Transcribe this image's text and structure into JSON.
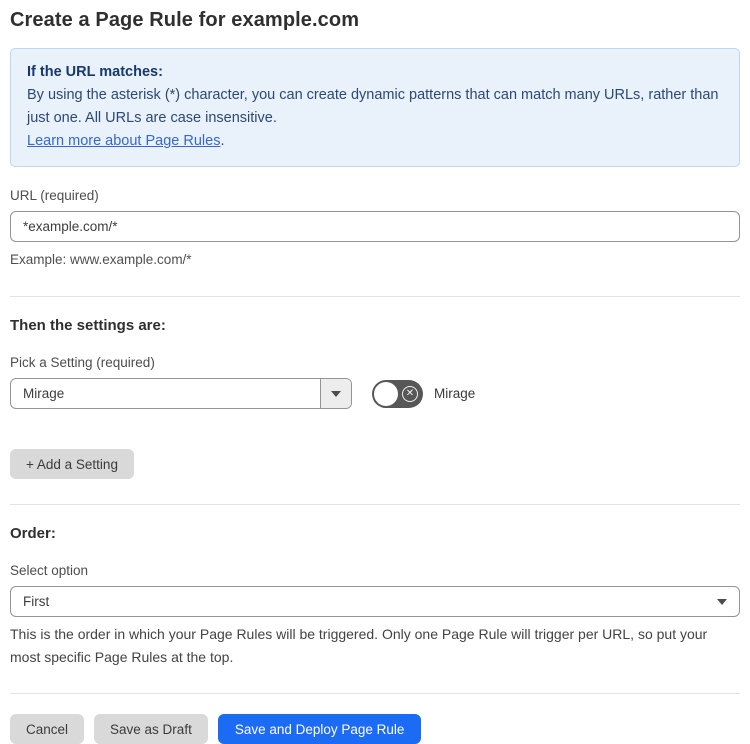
{
  "page": {
    "title": "Create a Page Rule for example.com"
  },
  "info_box": {
    "heading": "If the URL matches:",
    "body": "By using the asterisk (*) character, you can create dynamic patterns that can match many URLs, rather than just one. All URLs are case insensitive.",
    "link": "Learn more about Page Rules",
    "link_suffix": "."
  },
  "url_field": {
    "label": "URL (required)",
    "value": "*example.com/*",
    "helper": "Example: www.example.com/*"
  },
  "settings_section": {
    "heading": "Then the settings are:",
    "picker_label": "Pick a Setting (required)",
    "picker_value": "Mirage",
    "toggle_state": "off",
    "toggle_label": "Mirage",
    "add_button_label": "+ Add a Setting"
  },
  "order_section": {
    "heading": "Order:",
    "select_label": "Select option",
    "select_value": "First",
    "helper": "This is the order in which your Page Rules will be triggered. Only one Page Rule will trigger per URL, so put your most specific Page Rules at the top."
  },
  "footer": {
    "cancel_label": "Cancel",
    "save_draft_label": "Save as Draft",
    "save_deploy_label": "Save and Deploy Page Rule"
  },
  "colors": {
    "info_bg": "#e9f1fb",
    "info_border": "#bcd7f3",
    "info_text": "#17386d",
    "link": "#3569cb",
    "primary_button": "#1b6bf5",
    "gray_button": "#d9d9d9",
    "toggle_off": "#575757"
  }
}
